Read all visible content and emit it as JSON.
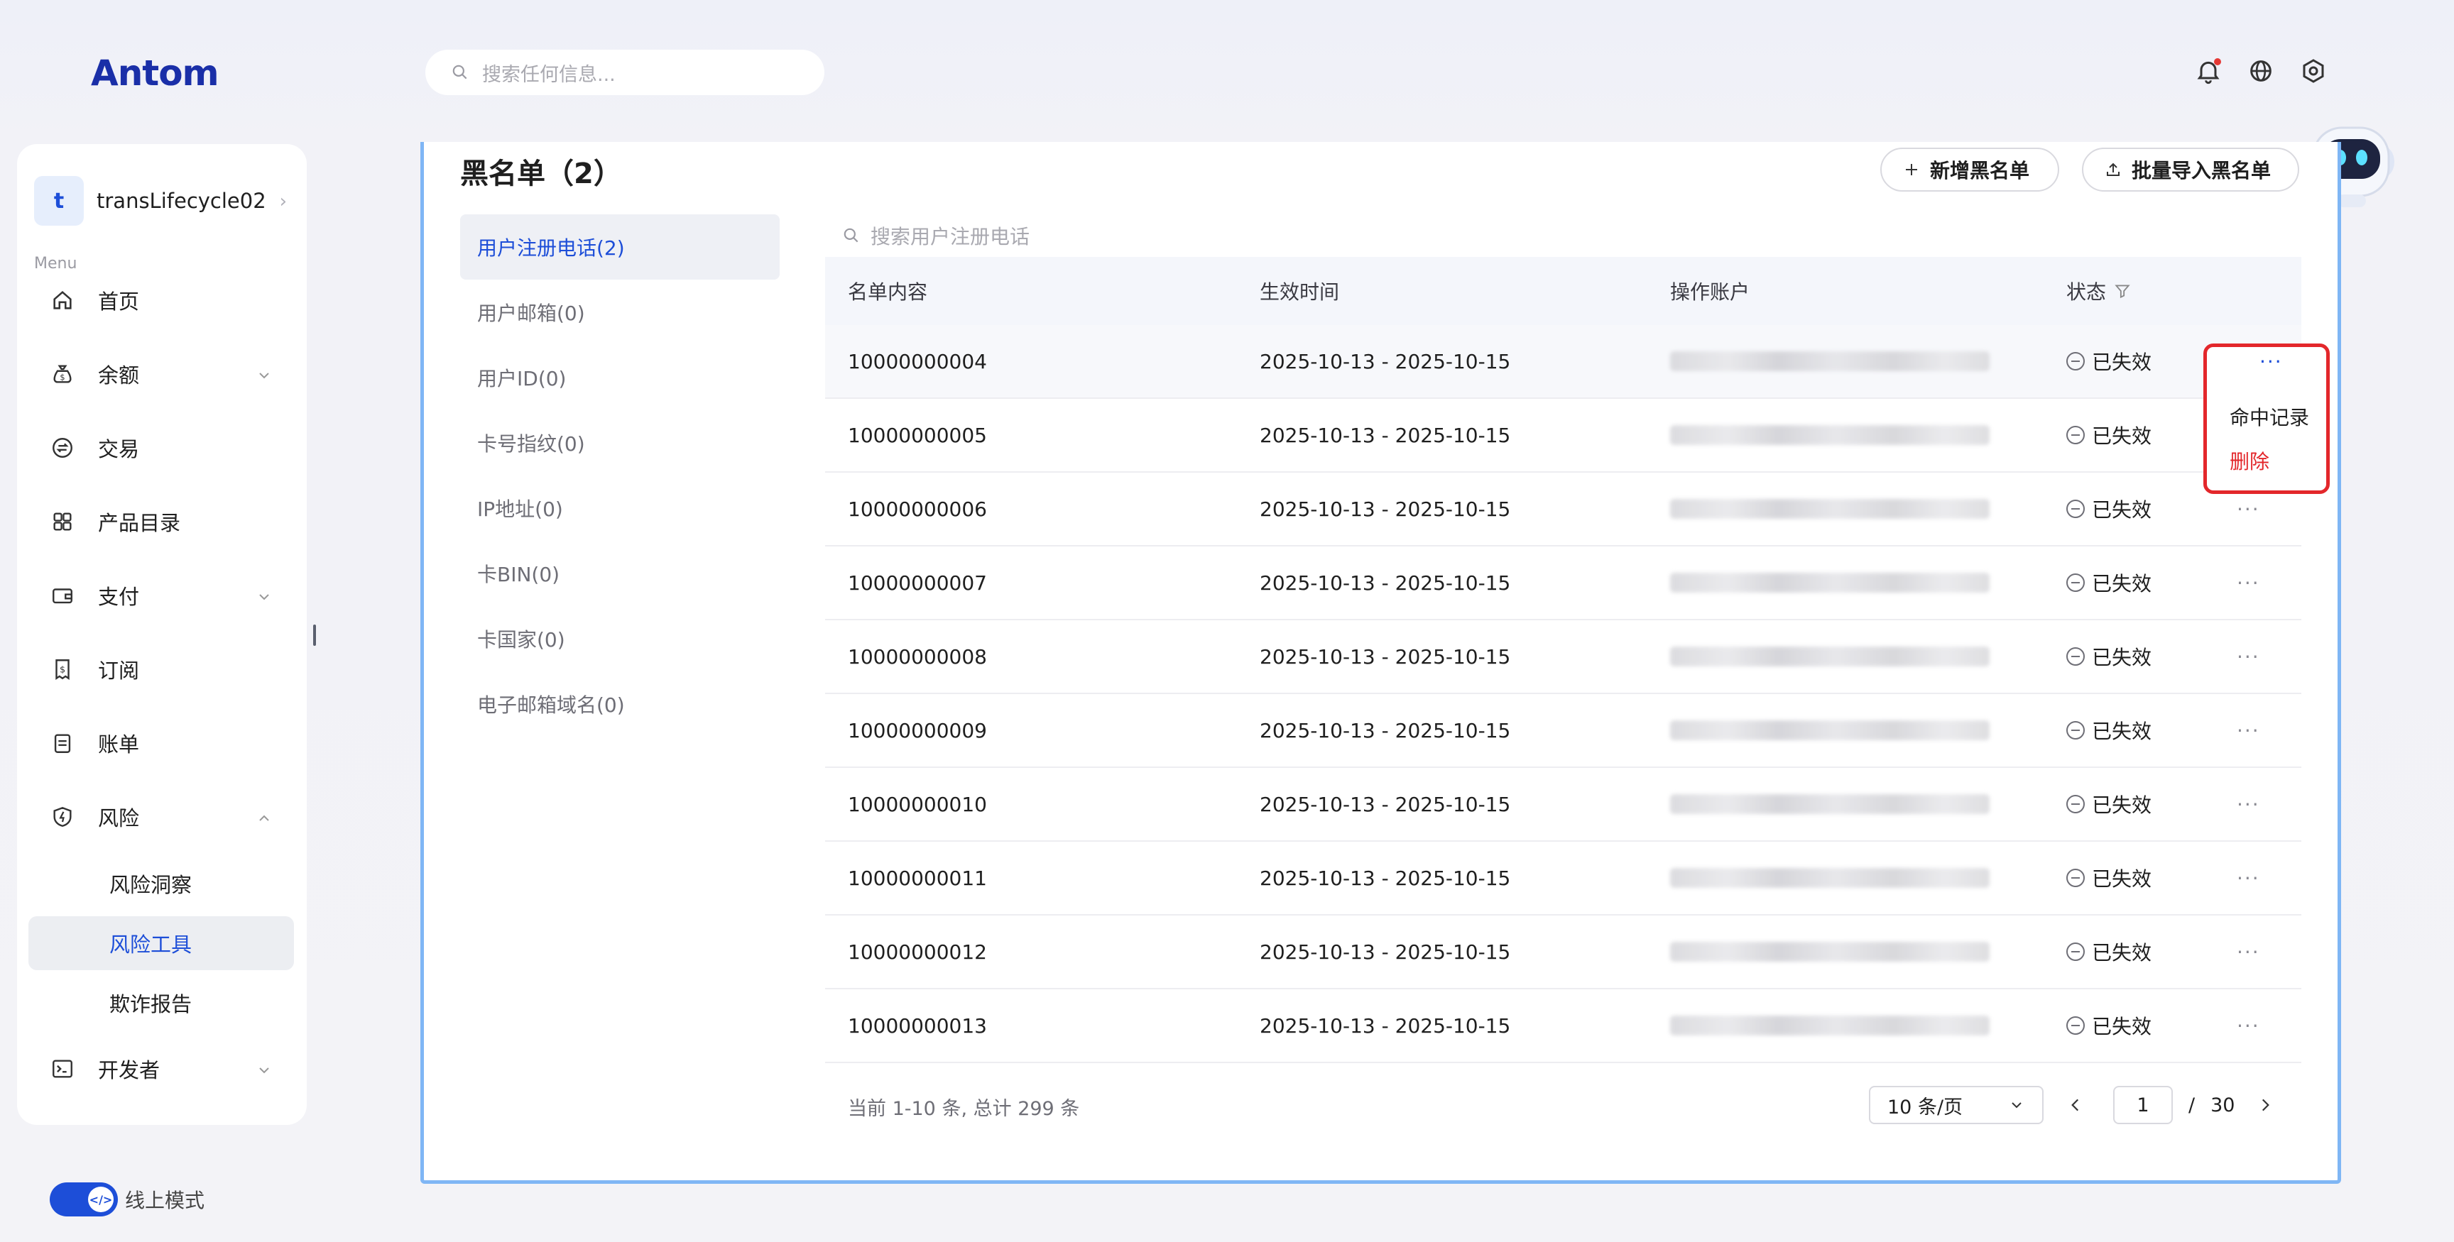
{
  "brand": {
    "logo_text": "Antom"
  },
  "search": {
    "placeholder": "搜索任何信息..."
  },
  "topbar": {
    "icons": [
      "bell-icon",
      "globe-icon",
      "settings-icon"
    ]
  },
  "sidebar": {
    "account": {
      "initial": "t",
      "name": "transLifecycle02"
    },
    "menu_caption": "Menu",
    "items": [
      {
        "label": "首页",
        "icon": "home-icon"
      },
      {
        "label": "余额",
        "icon": "money-bag-icon",
        "expandable": true
      },
      {
        "label": "交易",
        "icon": "exchange-icon"
      },
      {
        "label": "产品目录",
        "icon": "grid-icon"
      },
      {
        "label": "支付",
        "icon": "wallet-icon",
        "expandable": true
      },
      {
        "label": "订阅",
        "icon": "receipt-icon"
      },
      {
        "label": "账单",
        "icon": "clipboard-icon"
      },
      {
        "label": "风险",
        "icon": "shield-icon",
        "expanded": true
      },
      {
        "label": "开发者",
        "icon": "terminal-icon",
        "expandable": true
      }
    ],
    "risk_sub": [
      "风险洞察",
      "风险工具",
      "欺诈报告"
    ],
    "risk_sub_active": "风险工具",
    "mode_label": "线上模式"
  },
  "page": {
    "title": "黑名单（2）",
    "add_button": "新增黑名单",
    "import_button": "批量导入黑名单"
  },
  "categories": [
    "用户注册电话(2)",
    "用户邮箱(0)",
    "用户ID(0)",
    "卡号指纹(0)",
    "IP地址(0)",
    "卡BIN(0)",
    "卡国家(0)",
    "电子邮箱域名(0)"
  ],
  "table": {
    "search_placeholder": "搜索用户注册电话",
    "headers": [
      "名单内容",
      "生效时间",
      "操作账户",
      "状态"
    ],
    "rows": [
      {
        "content": "10000000004",
        "period": "2025-10-13 - 2025-10-15",
        "status": "已失效"
      },
      {
        "content": "10000000005",
        "period": "2025-10-13 - 2025-10-15",
        "status": "已失效"
      },
      {
        "content": "10000000006",
        "period": "2025-10-13 - 2025-10-15",
        "status": "已失效"
      },
      {
        "content": "10000000007",
        "period": "2025-10-13 - 2025-10-15",
        "status": "已失效"
      },
      {
        "content": "10000000008",
        "period": "2025-10-13 - 2025-10-15",
        "status": "已失效"
      },
      {
        "content": "10000000009",
        "period": "2025-10-13 - 2025-10-15",
        "status": "已失效"
      },
      {
        "content": "10000000010",
        "period": "2025-10-13 - 2025-10-15",
        "status": "已失效"
      },
      {
        "content": "10000000011",
        "period": "2025-10-13 - 2025-10-15",
        "status": "已失效"
      },
      {
        "content": "10000000012",
        "period": "2025-10-13 - 2025-10-15",
        "status": "已失效"
      },
      {
        "content": "10000000013",
        "period": "2025-10-13 - 2025-10-15",
        "status": "已失效"
      }
    ],
    "more_label": "···"
  },
  "row_menu": {
    "items": [
      "命中记录",
      "删除"
    ]
  },
  "pagination": {
    "summary": "当前 1-10 条, 总计 299 条",
    "page_size": "10 条/页",
    "current_page": "1",
    "separator": "/",
    "total_pages": "30"
  },
  "colors": {
    "accent": "#1d4ed8",
    "danger": "#e3272b",
    "highlight_border": "#7fb6f5"
  }
}
